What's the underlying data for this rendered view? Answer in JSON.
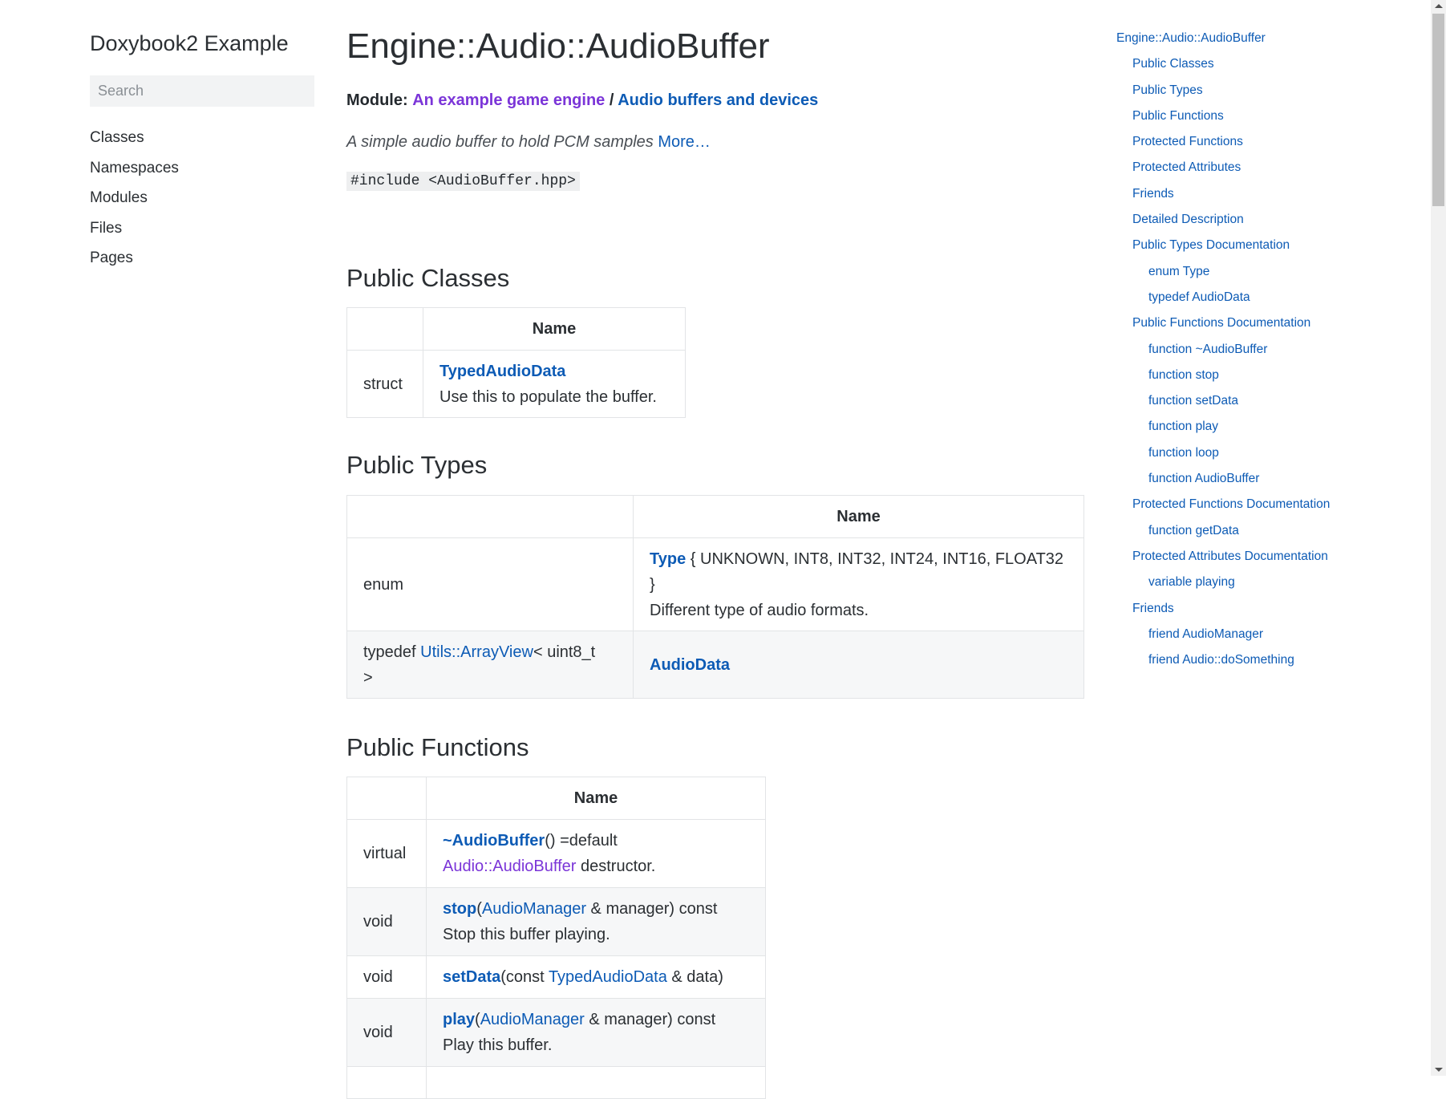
{
  "sidebar": {
    "site_title": "Doxybook2 Example",
    "search_placeholder": "Search",
    "nav": [
      "Classes",
      "Namespaces",
      "Modules",
      "Files",
      "Pages"
    ]
  },
  "main": {
    "title": "Engine::Audio::AudioBuffer",
    "module_label": "Module:",
    "module_link1": "An example game engine",
    "module_sep": " / ",
    "module_link2": "Audio buffers and devices",
    "brief": "A simple audio buffer to hold PCM samples",
    "brief_more": "More…",
    "include": "#include <AudioBuffer.hpp>",
    "public_classes": {
      "heading": "Public Classes",
      "name_header": "Name",
      "rows": [
        {
          "type": "struct",
          "name": "TypedAudioData",
          "desc": "Use this to populate the buffer."
        }
      ]
    },
    "public_types": {
      "heading": "Public Types",
      "name_header": "Name",
      "row1": {
        "type": "enum",
        "name": "Type",
        "sig1": " { UNKNOWN, INT8, INT32, INT24, INT16, FLOAT32",
        "sig2": "}",
        "desc": "Different type of audio formats."
      },
      "row2": {
        "type_pre": "typedef ",
        "type_link": "Utils::ArrayView",
        "type_post1": "< uint8_t",
        "type_post2": ">",
        "name": "AudioData"
      }
    },
    "public_functions": {
      "heading": "Public Functions",
      "name_header": "Name",
      "r1": {
        "type": "virtual",
        "name": "~AudioBuffer",
        "sig": "() =default",
        "desc_link": "Audio::AudioBuffer",
        "desc": " destructor."
      },
      "r2": {
        "type": "void",
        "name": "stop",
        "open": "(",
        "param_link": "AudioManager",
        "sig": " & manager) const",
        "desc": "Stop this buffer playing."
      },
      "r3": {
        "type": "void",
        "name": "setData",
        "open": "(const ",
        "param_link": "TypedAudioData",
        "sig": " & data)"
      },
      "r4": {
        "type": "void",
        "name": "play",
        "open": "(",
        "param_link": "AudioManager",
        "sig": " & manager) const",
        "desc": "Play this buffer."
      }
    }
  },
  "toc": [
    {
      "level": 0,
      "label": "Engine::Audio::AudioBuffer"
    },
    {
      "level": 1,
      "label": "Public Classes"
    },
    {
      "level": 1,
      "label": "Public Types"
    },
    {
      "level": 1,
      "label": "Public Functions"
    },
    {
      "level": 1,
      "label": "Protected Functions"
    },
    {
      "level": 1,
      "label": "Protected Attributes"
    },
    {
      "level": 1,
      "label": "Friends"
    },
    {
      "level": 1,
      "label": "Detailed Description"
    },
    {
      "level": 1,
      "label": "Public Types Documentation"
    },
    {
      "level": 2,
      "label": "enum Type"
    },
    {
      "level": 2,
      "label": "typedef AudioData"
    },
    {
      "level": 1,
      "label": "Public Functions Documentation"
    },
    {
      "level": 2,
      "label": "function ~AudioBuffer"
    },
    {
      "level": 2,
      "label": "function stop"
    },
    {
      "level": 2,
      "label": "function setData"
    },
    {
      "level": 2,
      "label": "function play"
    },
    {
      "level": 2,
      "label": "function loop"
    },
    {
      "level": 2,
      "label": "function AudioBuffer"
    },
    {
      "level": 1,
      "label": "Protected Functions Documentation"
    },
    {
      "level": 2,
      "label": "function getData"
    },
    {
      "level": 1,
      "label": "Protected Attributes Documentation"
    },
    {
      "level": 2,
      "label": "variable playing"
    },
    {
      "level": 1,
      "label": "Friends"
    },
    {
      "level": 2,
      "label": "friend AudioManager"
    },
    {
      "level": 2,
      "label": "friend Audio::doSomething"
    }
  ],
  "colors": {
    "link": "#0d5bb5",
    "visited_link": "#7b35d8",
    "text": "#2b2f33"
  }
}
